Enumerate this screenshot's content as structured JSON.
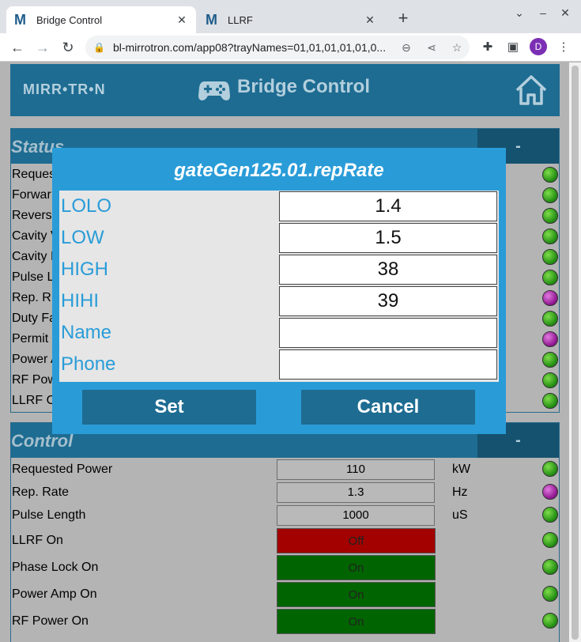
{
  "browser": {
    "tabs": [
      {
        "favicon": "M",
        "title": "Bridge Control",
        "close": "✕"
      },
      {
        "favicon": "M",
        "title": "LLRF",
        "close": "✕"
      }
    ],
    "new_tab": "+",
    "url": "bl-mirrotron.com/app08?trayNames=01,01,01,01,01,0...",
    "profile_initial": "D"
  },
  "app": {
    "logo": "MIRR•TR•N",
    "title": "Bridge Control"
  },
  "status_panel": {
    "title": "Status",
    "toggle": "-",
    "rows": [
      {
        "label": "Reques",
        "led": "green"
      },
      {
        "label": "Forwar",
        "led": "green"
      },
      {
        "label": "Revers",
        "led": "green"
      },
      {
        "label": "Cavity V",
        "led": "green"
      },
      {
        "label": "Cavity I",
        "led": "green"
      },
      {
        "label": "Pulse L",
        "led": "green"
      },
      {
        "label": "Rep. R",
        "led": "magenta"
      },
      {
        "label": "Duty Fa",
        "led": "green"
      },
      {
        "label": "Permit",
        "led": "magenta"
      },
      {
        "label": "Power A",
        "led": "green"
      },
      {
        "label": "RF Pow",
        "led": "green"
      },
      {
        "label": "LLRF O",
        "led": "green"
      }
    ]
  },
  "control_panel": {
    "title": "Control",
    "toggle": "-",
    "rows": [
      {
        "label": "Requested Power",
        "value": "110",
        "unit": "kW",
        "led": "green"
      },
      {
        "label": "Rep. Rate",
        "value": "1.3",
        "unit": "Hz",
        "led": "magenta"
      },
      {
        "label": "Pulse Length",
        "value": "1000",
        "unit": "uS",
        "led": "green"
      }
    ],
    "toggles": [
      {
        "label": "LLRF On",
        "state": "Off",
        "led": "green"
      },
      {
        "label": "Phase Lock On",
        "state": "On",
        "led": "green"
      },
      {
        "label": "Power Amp On",
        "state": "On",
        "led": "green"
      },
      {
        "label": "RF Power On",
        "state": "On",
        "led": "green"
      }
    ]
  },
  "modal": {
    "title": "gateGen125.01.repRate",
    "fields": [
      {
        "label": "LOLO",
        "value": "1.4"
      },
      {
        "label": "LOW",
        "value": "1.5"
      },
      {
        "label": "HIGH",
        "value": "38"
      },
      {
        "label": "HIHI",
        "value": "39"
      },
      {
        "label": "Name",
        "value": ""
      },
      {
        "label": "Phone",
        "value": ""
      }
    ],
    "set_label": "Set",
    "cancel_label": "Cancel"
  },
  "colors": {
    "header_blue": "#1e6c92",
    "modal_blue": "#299cd8",
    "off_red": "#a30000",
    "on_green": "#006400",
    "led_green": "#1f8a10",
    "led_magenta": "#8c128c"
  }
}
